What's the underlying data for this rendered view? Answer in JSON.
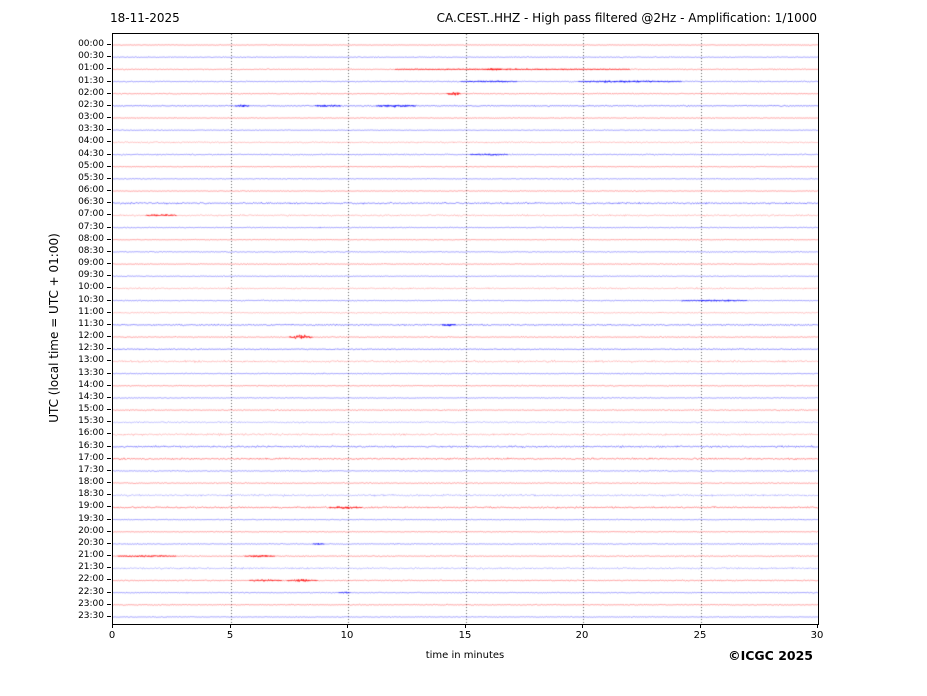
{
  "header": {
    "date": "18-11-2025",
    "title": "CA.CEST..HHZ - High pass filtered @2Hz - Amplification: 1/1000"
  },
  "footer": {
    "copyright": "©ICGC 2025"
  },
  "chart_data": {
    "type": "line",
    "subtype": "helicorder-seismogram",
    "title": "CA.CEST..HHZ - High pass filtered @2Hz - Amplification: 1/1000",
    "xlabel": "time in minutes",
    "ylabel": "UTC (local time = UTC + 01:00)",
    "xlim": [
      0,
      30
    ],
    "xticks": [
      0,
      5,
      10,
      15,
      20,
      25,
      30
    ],
    "grid": "vertical dotted gridlines every 5 minutes",
    "legend": "none",
    "colors": {
      "trace_red": "#ff0000",
      "trace_blue": "#0000ff",
      "grid": "#666666",
      "frame": "#000000"
    },
    "row_color_rule": "rows on the hour are red, rows on the half-hour are blue",
    "rows": [
      {
        "label": "00:00",
        "color": "red",
        "noise": 0.35,
        "style": "normal",
        "events": []
      },
      {
        "label": "00:30",
        "color": "blue",
        "noise": 0.45,
        "style": "normal",
        "events": []
      },
      {
        "label": "01:00",
        "color": "red",
        "noise": 0.5,
        "style": "normal",
        "events": [
          [
            12,
            22,
            0.55
          ],
          [
            15.9,
            16.5,
            1.5
          ]
        ]
      },
      {
        "label": "01:30",
        "color": "blue",
        "noise": 0.55,
        "style": "normal",
        "events": [
          [
            14.8,
            17.2,
            0.7
          ],
          [
            19.8,
            24.2,
            1.0
          ]
        ]
      },
      {
        "label": "02:00",
        "color": "red",
        "noise": 0.5,
        "style": "normal",
        "events": [
          [
            14.2,
            14.8,
            1.7
          ]
        ]
      },
      {
        "label": "02:30",
        "color": "blue",
        "noise": 0.6,
        "style": "dense",
        "events": [
          [
            5.2,
            5.8,
            1.1
          ],
          [
            8.6,
            9.7,
            1.1
          ],
          [
            11.2,
            12.9,
            1.4
          ]
        ]
      },
      {
        "label": "03:00",
        "color": "red",
        "noise": 0.4,
        "style": "normal",
        "events": []
      },
      {
        "label": "03:30",
        "color": "blue",
        "noise": 0.4,
        "style": "normal",
        "events": []
      },
      {
        "label": "04:00",
        "color": "red",
        "noise": 0.75,
        "style": "pale",
        "events": []
      },
      {
        "label": "04:30",
        "color": "blue",
        "noise": 0.6,
        "style": "normal",
        "events": [
          [
            15.2,
            16.8,
            0.8
          ]
        ]
      },
      {
        "label": "05:00",
        "color": "red",
        "noise": 0.4,
        "style": "normal",
        "events": []
      },
      {
        "label": "05:30",
        "color": "blue",
        "noise": 0.45,
        "style": "normal",
        "events": []
      },
      {
        "label": "06:00",
        "color": "red",
        "noise": 0.4,
        "style": "normal",
        "events": []
      },
      {
        "label": "06:30",
        "color": "blue",
        "noise": 0.85,
        "style": "dense",
        "events": []
      },
      {
        "label": "07:00",
        "color": "red",
        "noise": 0.8,
        "style": "pale",
        "events": [
          [
            1.4,
            2.7,
            0.9
          ]
        ]
      },
      {
        "label": "07:30",
        "color": "blue",
        "noise": 0.5,
        "style": "normal",
        "events": []
      },
      {
        "label": "08:00",
        "color": "red",
        "noise": 0.4,
        "style": "normal",
        "events": []
      },
      {
        "label": "08:30",
        "color": "blue",
        "noise": 0.5,
        "style": "normal",
        "events": []
      },
      {
        "label": "09:00",
        "color": "red",
        "noise": 0.45,
        "style": "normal",
        "events": []
      },
      {
        "label": "09:30",
        "color": "blue",
        "noise": 0.45,
        "style": "normal",
        "events": []
      },
      {
        "label": "10:00",
        "color": "red",
        "noise": 0.75,
        "style": "pale",
        "events": []
      },
      {
        "label": "10:30",
        "color": "blue",
        "noise": 0.5,
        "style": "normal",
        "events": [
          [
            24.2,
            27.0,
            0.7
          ]
        ]
      },
      {
        "label": "11:00",
        "color": "red",
        "noise": 0.6,
        "style": "pale",
        "events": []
      },
      {
        "label": "11:30",
        "color": "blue",
        "noise": 0.75,
        "style": "dense",
        "events": [
          [
            14.0,
            14.6,
            1.1
          ]
        ]
      },
      {
        "label": "12:00",
        "color": "red",
        "noise": 0.5,
        "style": "normal",
        "events": [
          [
            7.5,
            8.5,
            2.6
          ]
        ]
      },
      {
        "label": "12:30",
        "color": "blue",
        "noise": 0.6,
        "style": "dense",
        "events": []
      },
      {
        "label": "13:00",
        "color": "red",
        "noise": 0.95,
        "style": "pale",
        "events": []
      },
      {
        "label": "13:30",
        "color": "blue",
        "noise": 0.5,
        "style": "normal",
        "events": []
      },
      {
        "label": "14:00",
        "color": "red",
        "noise": 0.5,
        "style": "normal",
        "events": []
      },
      {
        "label": "14:30",
        "color": "blue",
        "noise": 0.5,
        "style": "normal",
        "events": []
      },
      {
        "label": "15:00",
        "color": "red",
        "noise": 0.55,
        "style": "normal",
        "events": []
      },
      {
        "label": "15:30",
        "color": "blue",
        "noise": 0.75,
        "style": "pale",
        "events": []
      },
      {
        "label": "16:00",
        "color": "red",
        "noise": 0.95,
        "style": "pale",
        "events": []
      },
      {
        "label": "16:30",
        "color": "blue",
        "noise": 0.9,
        "style": "dense",
        "events": []
      },
      {
        "label": "17:00",
        "color": "red",
        "noise": 0.85,
        "style": "dense",
        "events": []
      },
      {
        "label": "17:30",
        "color": "blue",
        "noise": 0.55,
        "style": "normal",
        "events": []
      },
      {
        "label": "18:00",
        "color": "red",
        "noise": 0.5,
        "style": "normal",
        "events": []
      },
      {
        "label": "18:30",
        "color": "blue",
        "noise": 0.95,
        "style": "pale",
        "events": []
      },
      {
        "label": "19:00",
        "color": "red",
        "noise": 0.8,
        "style": "dense",
        "events": [
          [
            9.2,
            10.6,
            1.1
          ]
        ]
      },
      {
        "label": "19:30",
        "color": "blue",
        "noise": 0.45,
        "style": "normal",
        "events": []
      },
      {
        "label": "20:00",
        "color": "red",
        "noise": 0.45,
        "style": "normal",
        "events": []
      },
      {
        "label": "20:30",
        "color": "blue",
        "noise": 0.5,
        "style": "normal",
        "events": [
          [
            8.5,
            9.0,
            1.0
          ]
        ]
      },
      {
        "label": "21:00",
        "color": "red",
        "noise": 0.55,
        "style": "normal",
        "events": [
          [
            0.2,
            2.7,
            0.8
          ],
          [
            5.6,
            6.9,
            1.0
          ]
        ]
      },
      {
        "label": "21:30",
        "color": "blue",
        "noise": 0.85,
        "style": "pale",
        "events": []
      },
      {
        "label": "22:00",
        "color": "red",
        "noise": 0.6,
        "style": "normal",
        "events": [
          [
            5.8,
            7.2,
            0.9
          ],
          [
            7.4,
            8.7,
            1.3
          ]
        ]
      },
      {
        "label": "22:30",
        "color": "blue",
        "noise": 0.5,
        "style": "normal",
        "events": [
          [
            9.6,
            10.1,
            0.9
          ]
        ]
      },
      {
        "label": "23:00",
        "color": "red",
        "noise": 0.5,
        "style": "normal",
        "events": []
      },
      {
        "label": "23:30",
        "color": "blue",
        "noise": 0.45,
        "style": "normal",
        "events": []
      }
    ],
    "events_note": "events are [start_minute, end_minute, relative_amplitude] bursts visible on the trace"
  }
}
